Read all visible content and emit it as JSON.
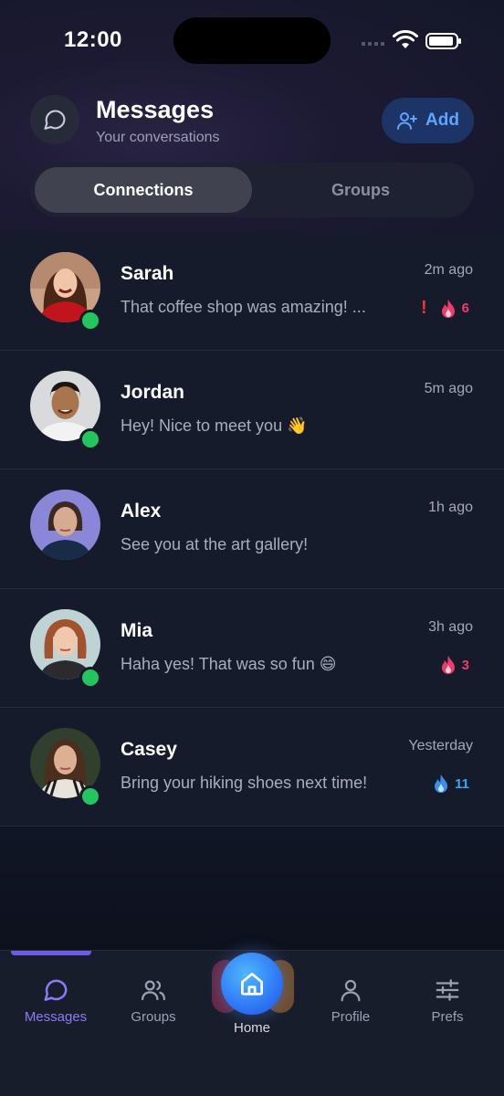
{
  "status_bar": {
    "time": "12:00"
  },
  "header": {
    "title": "Messages",
    "subtitle": "Your conversations",
    "add_label": "Add"
  },
  "tabs": [
    {
      "label": "Connections",
      "active": true
    },
    {
      "label": "Groups",
      "active": false
    }
  ],
  "conversations": [
    {
      "name": "Sarah",
      "preview": "That coffee shop was amazing! ...",
      "time": "2m ago",
      "online": true,
      "alert": "!",
      "streak": "6",
      "streak_color": "#ef3b6a"
    },
    {
      "name": "Jordan",
      "preview": "Hey! Nice to meet you 👋",
      "time": "5m ago",
      "online": true
    },
    {
      "name": "Alex",
      "preview": "See you at the art gallery!",
      "time": "1h ago",
      "online": false
    },
    {
      "name": "Mia",
      "preview": "Haha yes! That was so fun 😄",
      "time": "3h ago",
      "online": true,
      "streak": "3",
      "streak_color": "#ef3b6a"
    },
    {
      "name": "Casey",
      "preview": "Bring your hiking shoes next time!",
      "time": "Yesterday",
      "online": true,
      "streak": "11",
      "streak_color": "#38a9f0"
    }
  ],
  "nav": {
    "messages": "Messages",
    "groups": "Groups",
    "home": "Home",
    "profile": "Profile",
    "prefs": "Prefs",
    "active": "messages"
  },
  "colors": {
    "accent": "#8b7cf6",
    "online": "#22c55e",
    "add_button_text": "#5fa4ff",
    "alert": "#ef3340"
  }
}
